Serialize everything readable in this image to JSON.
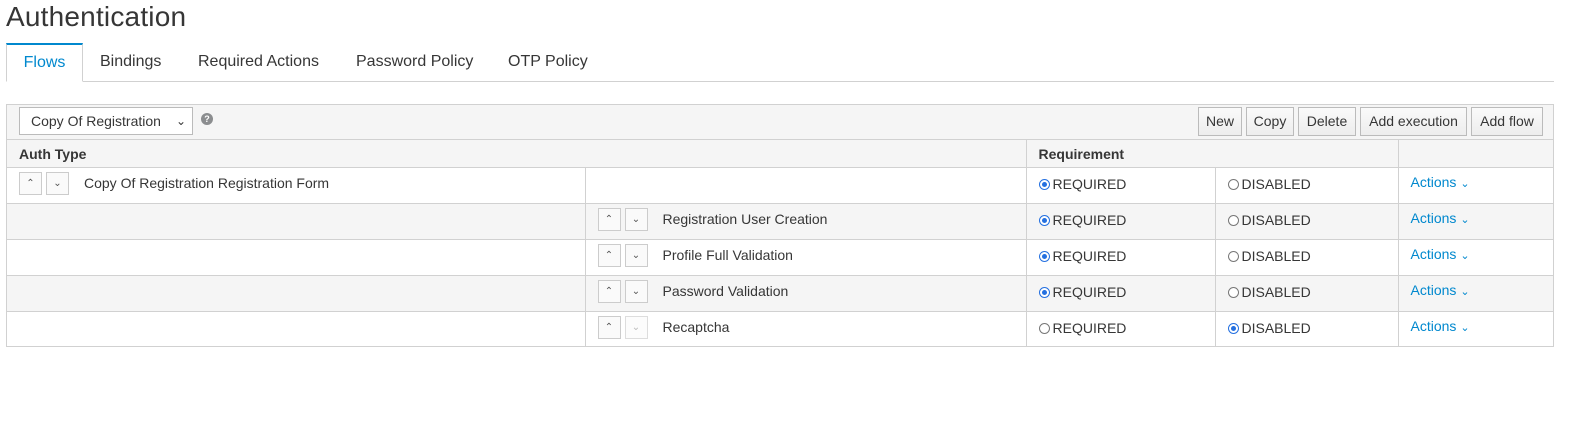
{
  "page": {
    "title": "Authentication"
  },
  "tabs": [
    "Flows",
    "Bindings",
    "Required Actions",
    "Password Policy",
    "OTP Policy"
  ],
  "active_tab": "Flows",
  "toolbar": {
    "flow_select_value": "Copy Of Registration",
    "help_glyph": "?",
    "buttons": {
      "new": "New",
      "copy": "Copy",
      "delete": "Delete",
      "add_execution": "Add execution",
      "add_flow": "Add flow"
    }
  },
  "table": {
    "headers": {
      "auth_type": "Auth Type",
      "requirement": "Requirement",
      "actions": ""
    },
    "rows": [
      {
        "name": "Copy Of Registration Registration Form",
        "level": 0,
        "required_label": "REQUIRED",
        "disabled_label": "DISABLED",
        "selected": "REQUIRED",
        "actions_label": "Actions",
        "down_disabled": false
      },
      {
        "name": "Registration User Creation",
        "level": 1,
        "required_label": "REQUIRED",
        "disabled_label": "DISABLED",
        "selected": "REQUIRED",
        "actions_label": "Actions",
        "down_disabled": false
      },
      {
        "name": "Profile Full Validation",
        "level": 1,
        "required_label": "REQUIRED",
        "disabled_label": "DISABLED",
        "selected": "REQUIRED",
        "actions_label": "Actions",
        "down_disabled": false
      },
      {
        "name": "Password Validation",
        "level": 1,
        "required_label": "REQUIRED",
        "disabled_label": "DISABLED",
        "selected": "REQUIRED",
        "actions_label": "Actions",
        "down_disabled": false
      },
      {
        "name": "Recaptcha",
        "level": 1,
        "required_label": "REQUIRED",
        "disabled_label": "DISABLED",
        "selected": "DISABLED",
        "actions_label": "Actions",
        "down_disabled": true
      }
    ]
  },
  "colors": {
    "accent": "#0088ce",
    "radio": "#2470e0",
    "border": "#d1d1d1"
  }
}
